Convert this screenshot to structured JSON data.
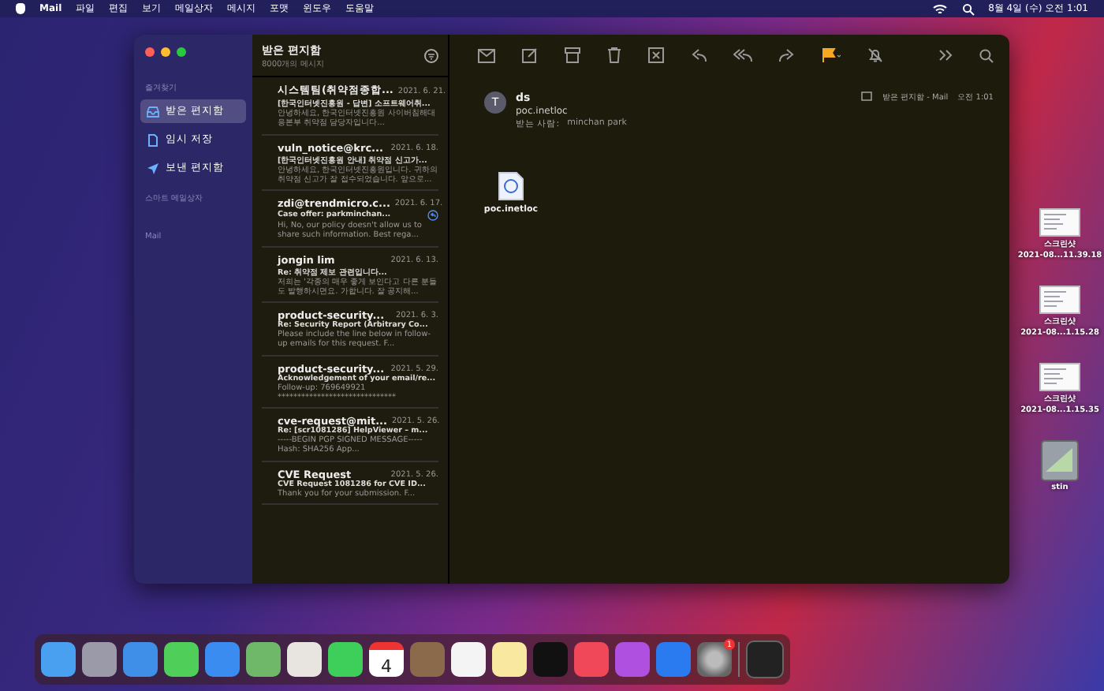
{
  "menubar": {
    "app": "Mail",
    "items": [
      "파일",
      "편집",
      "보기",
      "메일상자",
      "메시지",
      "포맷",
      "윈도우",
      "도움말"
    ],
    "clock": "8월 4일 (수) 오전 1:01"
  },
  "sidebar": {
    "favorites_heading": "즐겨찾기",
    "items": [
      {
        "label": "받은 편지함",
        "kind": "inbox",
        "selected": true
      },
      {
        "label": "임시 저장",
        "kind": "drafts",
        "selected": false
      },
      {
        "label": "보낸 편지함",
        "kind": "sent",
        "selected": false
      }
    ],
    "smart_heading": "스마트 메일상자",
    "account_heading": "Mail"
  },
  "message_list": {
    "title": "받은 편지함",
    "subtitle": "8000개의 메시지",
    "messages": [
      {
        "sender": "시스템팀(취약점종합...",
        "date": "2021. 6. 21.",
        "subject": "[한국인터넷진흥원 - 답변] 소프트웨어취...",
        "preview": "안녕하세요, 한국인터넷진흥원 사이버침해대응본부 취약점 담당자입니다...",
        "replied": false
      },
      {
        "sender": "vuln_notice@krc...",
        "date": "2021. 6. 18.",
        "subject": "[한국인터넷진흥원 안내] 취약점 신고가...",
        "preview": "안녕하세요, 한국인터넷진흥원입니다. 귀하의 취약점 신고가 잘 접수되었습니다. 앞으로...",
        "replied": false
      },
      {
        "sender": "zdi@trendmicro.c...",
        "date": "2021. 6. 17.",
        "subject": "Case offer: parkminchan...",
        "preview": "Hi, No, our policy doesn't allow us to share such information. Best rega...",
        "replied": true
      },
      {
        "sender": "jongin lim",
        "date": "2021. 6. 13.",
        "subject": "Re: 취약점 제보 관련입니다...",
        "preview": "저희는 '각종의 매우 좋게 보인다고 다른 분들도 발행하시면요. 가합니다. 잘 공지해...",
        "replied": false
      },
      {
        "sender": "product-security...",
        "date": "2021. 6. 3.",
        "subject": "Re: Security Report (Arbitrary Co...",
        "preview": "Please include the line below in follow-up emails for this request. F...",
        "replied": false
      },
      {
        "sender": "product-security...",
        "date": "2021. 5. 29.",
        "subject": "Acknowledgement of your email/re...",
        "preview": "Follow-up: 769649921 ******************************",
        "replied": false
      },
      {
        "sender": "cve-request@mit...",
        "date": "2021. 5. 26.",
        "subject": "Re: [scr1081286] HelpViewer – m...",
        "preview": "-----BEGIN PGP SIGNED MESSAGE----- Hash: SHA256 App...",
        "replied": false
      },
      {
        "sender": "CVE Request",
        "date": "2021. 5. 26.",
        "subject": "CVE Request 1081286 for CVE ID...",
        "preview": "Thank you for your submission. F...",
        "replied": false
      }
    ]
  },
  "viewer": {
    "avatar": "T",
    "sender": "ds",
    "subject": "poc.inetloc",
    "to_label": "받는 사람:",
    "to": "minchan park",
    "mailbox": "받은 편지함 - Mail",
    "time": "오전 1:01",
    "attachment": "poc.inetloc"
  },
  "desktop_icons": [
    {
      "name": "스크린샷",
      "detail": "2021-08...11.39.18",
      "kind": "screenshot"
    },
    {
      "name": "스크린샷",
      "detail": "2021-08...1.15.28",
      "kind": "screenshot"
    },
    {
      "name": "스크린샷",
      "detail": "2021-08...1.15.35",
      "kind": "screenshot"
    },
    {
      "name": "stin",
      "kind": "disk"
    }
  ],
  "dock": {
    "calendar_day": "4",
    "badge": "1"
  }
}
